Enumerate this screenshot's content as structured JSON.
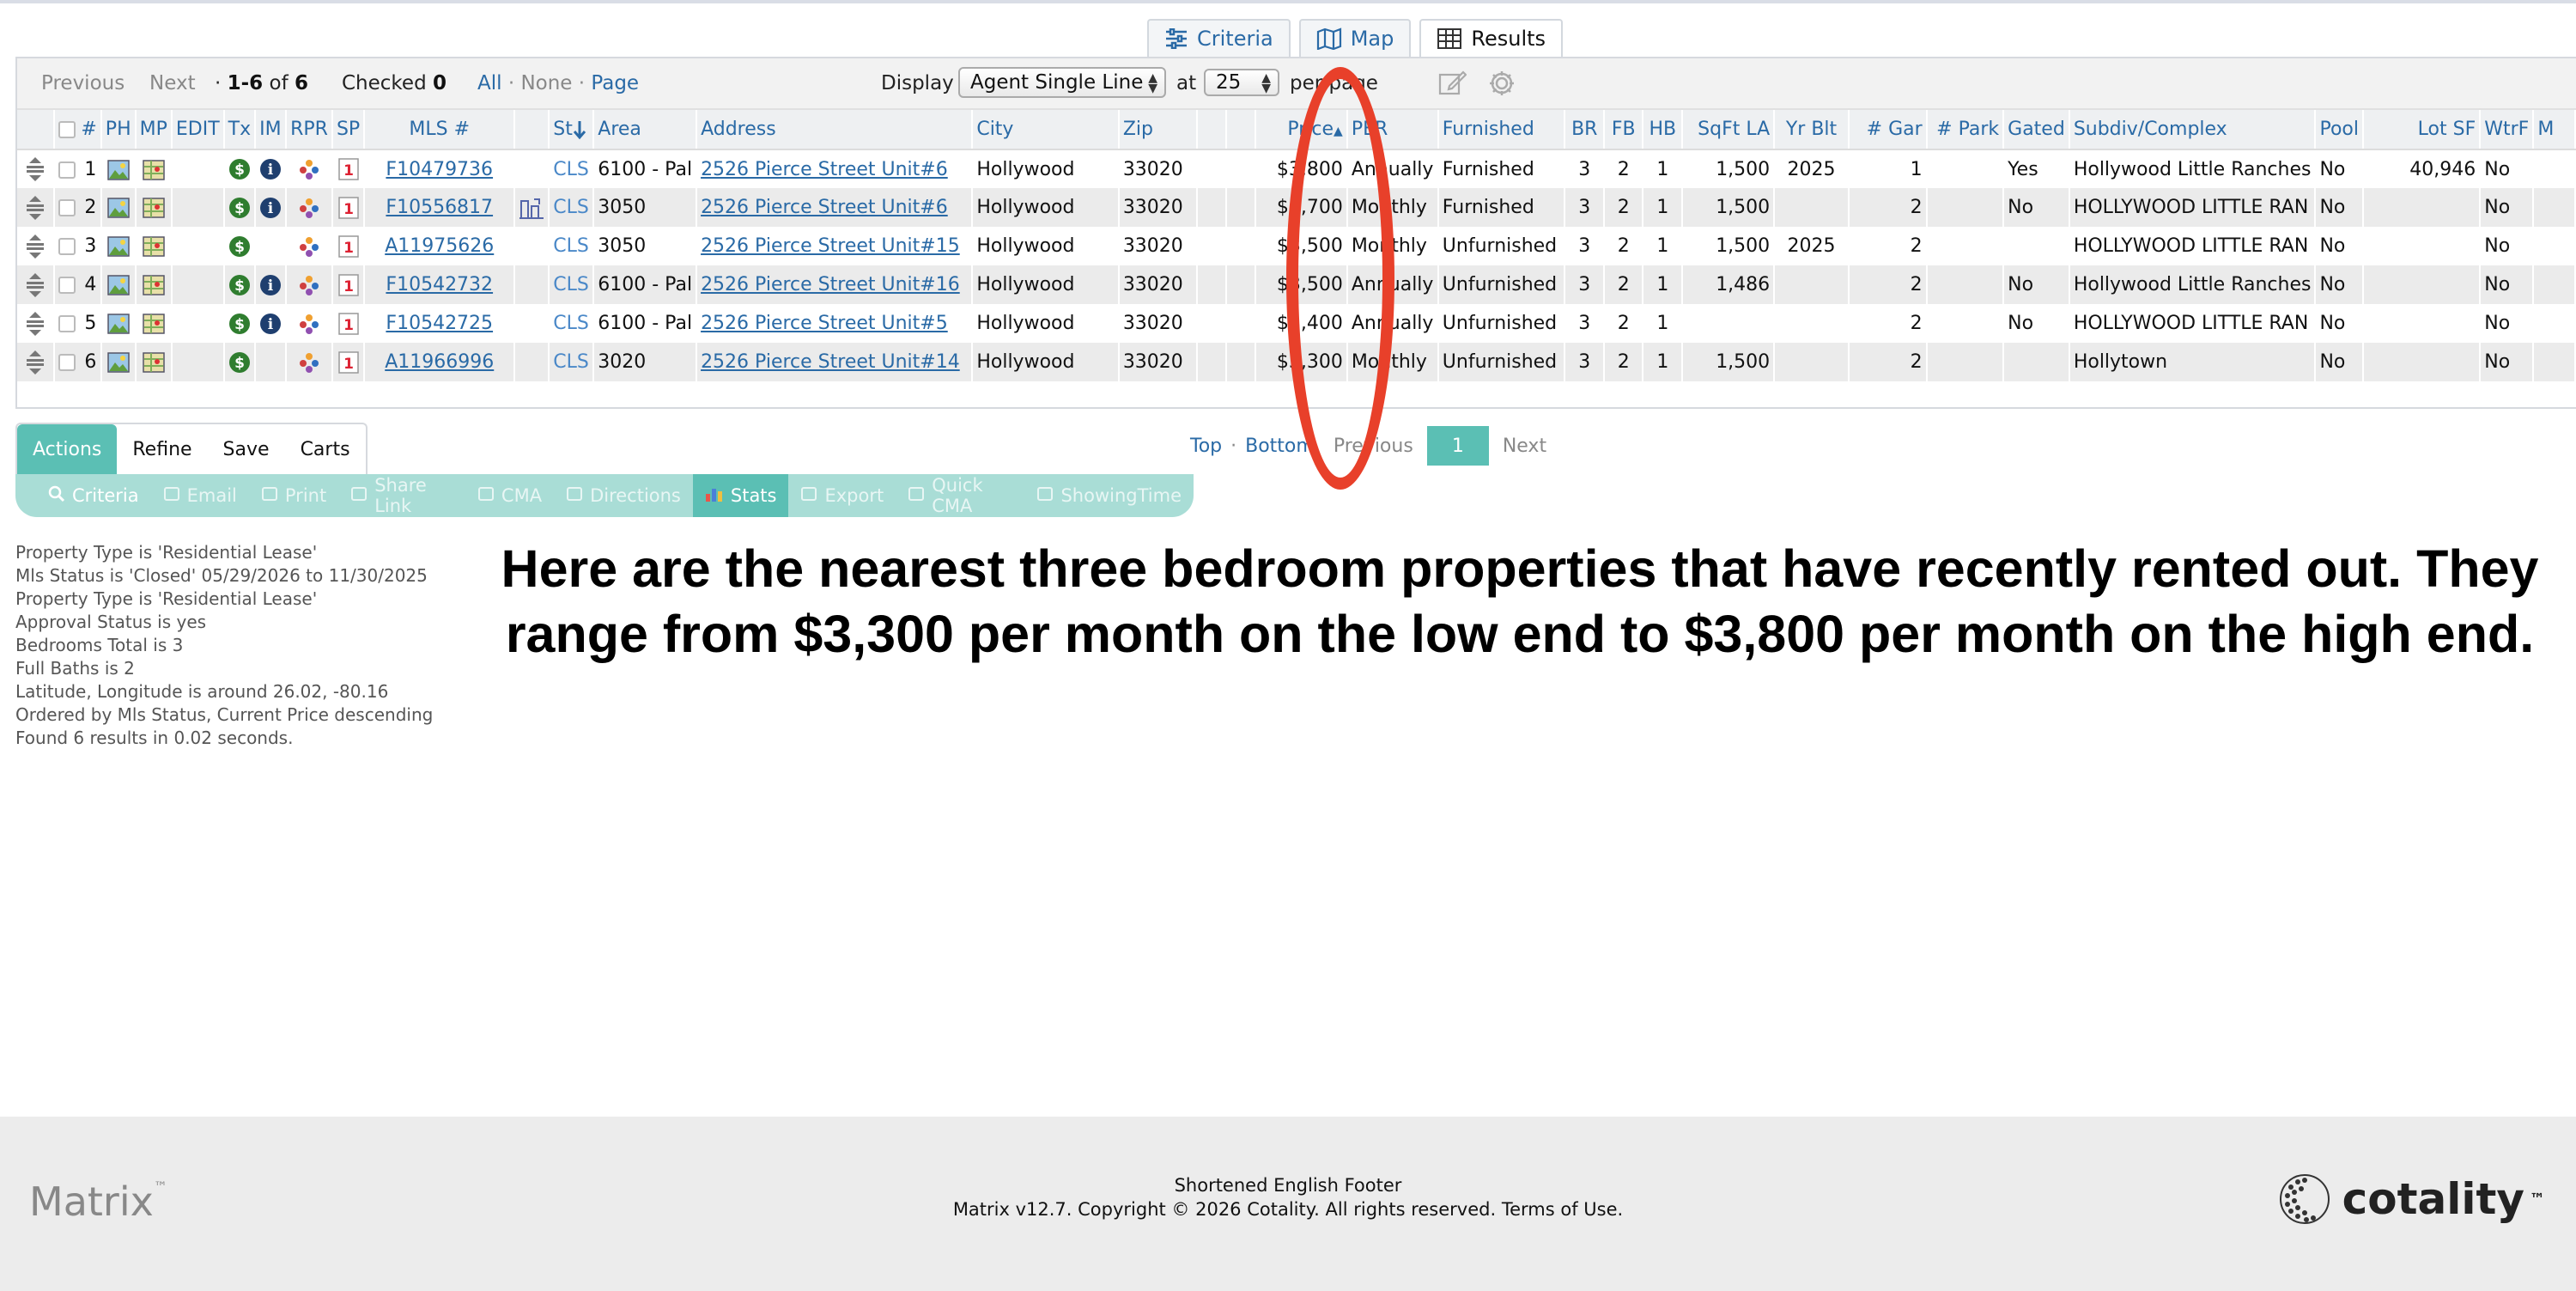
{
  "view_tabs": [
    {
      "label": "Criteria",
      "icon": "sliders-icon"
    },
    {
      "label": "Map",
      "icon": "map-icon"
    },
    {
      "label": "Results",
      "icon": "table-icon"
    }
  ],
  "toolbar": {
    "previous": "Previous",
    "next": "Next",
    "range_prefix": "·",
    "range": "1-6",
    "of_label": "of",
    "total": "6",
    "checked_label": "Checked",
    "checked_count": "0",
    "all": "All",
    "sep1": "·",
    "none": "None",
    "sep2": "·",
    "page": "Page",
    "display_label": "Display",
    "display_value": "Agent Single Line",
    "at_label": "at",
    "per_page_value": "25",
    "per_page_label": "per page"
  },
  "table": {
    "headers": [
      "",
      "#",
      "PH",
      "MP",
      "EDIT",
      "Tx",
      "IM",
      "RPR",
      "SP",
      "MLS #",
      "",
      "St",
      "Area",
      "Address",
      "City",
      "Zip",
      "",
      "",
      "Price",
      "PER",
      "Furnished",
      "BR",
      "FB",
      "HB",
      "SqFt LA",
      "Yr Blt",
      "# Gar",
      "# Park",
      "Gated",
      "Subdiv/Complex",
      "Pool",
      "Lot SF",
      "WtrF",
      "M"
    ],
    "rows": [
      {
        "num": "1",
        "im": true,
        "virtual": false,
        "mls": "F10479736",
        "st": "CLS",
        "area": "6100 - Pal",
        "address": "2526 Pierce Street Unit#6",
        "city": "Hollywood",
        "zip": "33020",
        "price": "$3,800",
        "per": "Annually",
        "furnished": "Furnished",
        "br": "3",
        "fb": "2",
        "hb": "1",
        "sqft": "1,500",
        "yrblt": "2025",
        "gar": "1",
        "park": "",
        "gated": "Yes",
        "subdiv": "Hollywood Little Ranches",
        "pool": "No",
        "lotsf": "40,946",
        "wtrf": "No"
      },
      {
        "num": "2",
        "im": true,
        "virtual": true,
        "mls": "F10556817",
        "st": "CLS",
        "area": "3050",
        "address": "2526 Pierce Street Unit#6",
        "city": "Hollywood",
        "zip": "33020",
        "price": "$3,700",
        "per": "Monthly",
        "furnished": "Furnished",
        "br": "3",
        "fb": "2",
        "hb": "1",
        "sqft": "1,500",
        "yrblt": "",
        "gar": "2",
        "park": "",
        "gated": "No",
        "subdiv": "HOLLYWOOD LITTLE RAN",
        "pool": "No",
        "lotsf": "",
        "wtrf": "No"
      },
      {
        "num": "3",
        "im": false,
        "virtual": false,
        "mls": "A11975626",
        "st": "CLS",
        "area": "3050",
        "address": "2526 Pierce Street Unit#15",
        "city": "Hollywood",
        "zip": "33020",
        "price": "$3,500",
        "per": "Monthly",
        "furnished": "Unfurnished",
        "br": "3",
        "fb": "2",
        "hb": "1",
        "sqft": "1,500",
        "yrblt": "2025",
        "gar": "2",
        "park": "",
        "gated": "",
        "subdiv": "HOLLYWOOD LITTLE RAN",
        "pool": "No",
        "lotsf": "",
        "wtrf": "No"
      },
      {
        "num": "4",
        "im": true,
        "virtual": false,
        "mls": "F10542732",
        "st": "CLS",
        "area": "6100 - Pal",
        "address": "2526 Pierce Street Unit#16",
        "city": "Hollywood",
        "zip": "33020",
        "price": "$3,500",
        "per": "Annually",
        "furnished": "Unfurnished",
        "br": "3",
        "fb": "2",
        "hb": "1",
        "sqft": "1,486",
        "yrblt": "",
        "gar": "2",
        "park": "",
        "gated": "No",
        "subdiv": "Hollywood Little Ranches",
        "pool": "No",
        "lotsf": "",
        "wtrf": "No"
      },
      {
        "num": "5",
        "im": true,
        "virtual": false,
        "mls": "F10542725",
        "st": "CLS",
        "area": "6100 - Pal",
        "address": "2526 Pierce Street Unit#5",
        "city": "Hollywood",
        "zip": "33020",
        "price": "$3,400",
        "per": "Annually",
        "furnished": "Unfurnished",
        "br": "3",
        "fb": "2",
        "hb": "1",
        "sqft": "",
        "yrblt": "",
        "gar": "2",
        "park": "",
        "gated": "No",
        "subdiv": "HOLLYWOOD LITTLE RAN",
        "pool": "No",
        "lotsf": "",
        "wtrf": "No"
      },
      {
        "num": "6",
        "im": false,
        "virtual": false,
        "mls": "A11966996",
        "st": "CLS",
        "area": "3020",
        "address": "2526 Pierce Street Unit#14",
        "city": "Hollywood",
        "zip": "33020",
        "price": "$3,300",
        "per": "Monthly",
        "furnished": "Unfurnished",
        "br": "3",
        "fb": "2",
        "hb": "1",
        "sqft": "1,500",
        "yrblt": "",
        "gar": "2",
        "park": "",
        "gated": "",
        "subdiv": "Hollytown",
        "pool": "No",
        "lotsf": "",
        "wtrf": "No"
      }
    ]
  },
  "pager": {
    "top": "Top",
    "sep": "·",
    "bottom": "Bottom",
    "previous": "Previous",
    "current": "1",
    "next": "Next"
  },
  "actions": {
    "tabs": [
      "Actions",
      "Refine",
      "Save",
      "Carts"
    ],
    "buttons": [
      {
        "label": "Criteria",
        "icon": "search-icon",
        "enabled": true
      },
      {
        "label": "Email",
        "icon": "email-icon",
        "enabled": false
      },
      {
        "label": "Print",
        "icon": "print-icon",
        "enabled": false
      },
      {
        "label": "Share Link",
        "icon": "share-link-icon",
        "enabled": false
      },
      {
        "label": "CMA",
        "icon": "cma-icon",
        "enabled": false
      },
      {
        "label": "Directions",
        "icon": "directions-icon",
        "enabled": false
      },
      {
        "label": "Stats",
        "icon": "stats-icon",
        "enabled": true
      },
      {
        "label": "Export",
        "icon": "export-icon",
        "enabled": false
      },
      {
        "label": "Quick CMA",
        "icon": "quick-cma-icon",
        "enabled": false
      },
      {
        "label": "ShowingTime",
        "icon": "showingtime-icon",
        "enabled": false
      }
    ]
  },
  "criteria_summary": [
    "Property Type is 'Residential Lease'",
    "Mls Status is 'Closed' 05/29/2026 to 11/30/2025",
    "Property Type is 'Residential Lease'",
    "Approval Status is yes",
    "Bedrooms Total is 3",
    "Full Baths is 2",
    "Latitude, Longitude is around 26.02, -80.16",
    "Ordered by Mls Status, Current Price descending",
    "Found 6 results in 0.02 seconds."
  ],
  "annotation": "Here are the nearest three bedroom properties that have recently rented out. They range from $3,300 per month on the low end to $3,800 per month on the high end.",
  "footer": {
    "logo_left": "Matrix",
    "logo_left_tm": "™",
    "line1": "Shortened English Footer",
    "copyright": "Matrix v12.7. Copyright © 2026 Cotality. All rights reserved.",
    "terms": "Terms of Use.",
    "logo_right": "cotality",
    "logo_right_tm": "™"
  },
  "colors": {
    "accent_teal": "#5bbfb4",
    "link_blue": "#2a6aa6",
    "annotation_red": "#e8402a"
  }
}
